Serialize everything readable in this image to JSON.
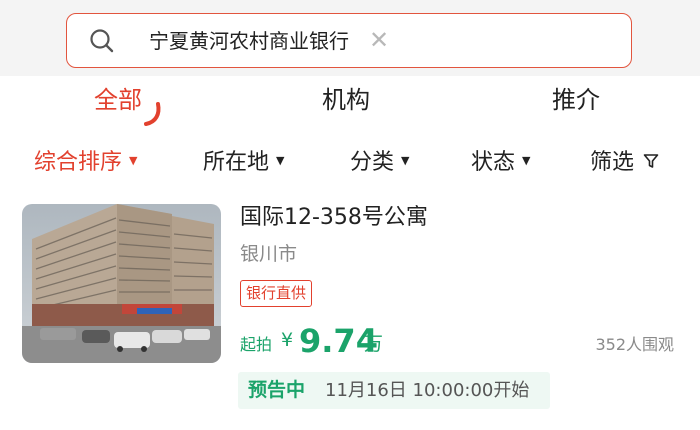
{
  "search": {
    "query": "宁夏黄河农村商业银行",
    "icon": "search-icon",
    "clear_icon": "close-icon"
  },
  "tabs": [
    {
      "label": "全部",
      "active": true
    },
    {
      "label": "机构",
      "active": false
    },
    {
      "label": "推介",
      "active": false
    }
  ],
  "filters": [
    {
      "label": "综合排序",
      "active": true,
      "icon": "caret-down-icon"
    },
    {
      "label": "所在地",
      "active": false,
      "icon": "caret-down-icon"
    },
    {
      "label": "分类",
      "active": false,
      "icon": "caret-down-icon"
    },
    {
      "label": "状态",
      "active": false,
      "icon": "caret-down-icon"
    },
    {
      "label": "筛选",
      "active": false,
      "icon": "filter-funnel-icon"
    }
  ],
  "listing": {
    "title": "国际12-358号公寓",
    "city": "银川市",
    "badge": "银行直供",
    "price_label": "起拍",
    "price_symbol": "¥",
    "price_value": "9.74",
    "price_unit": "万",
    "views": "352人围观",
    "status": "预告中",
    "start_time": "11月16日 10:00:00开始"
  },
  "colors": {
    "accent_red": "#e2412e",
    "price_green": "#1ba36a",
    "preview_bg": "#eef8f3"
  }
}
